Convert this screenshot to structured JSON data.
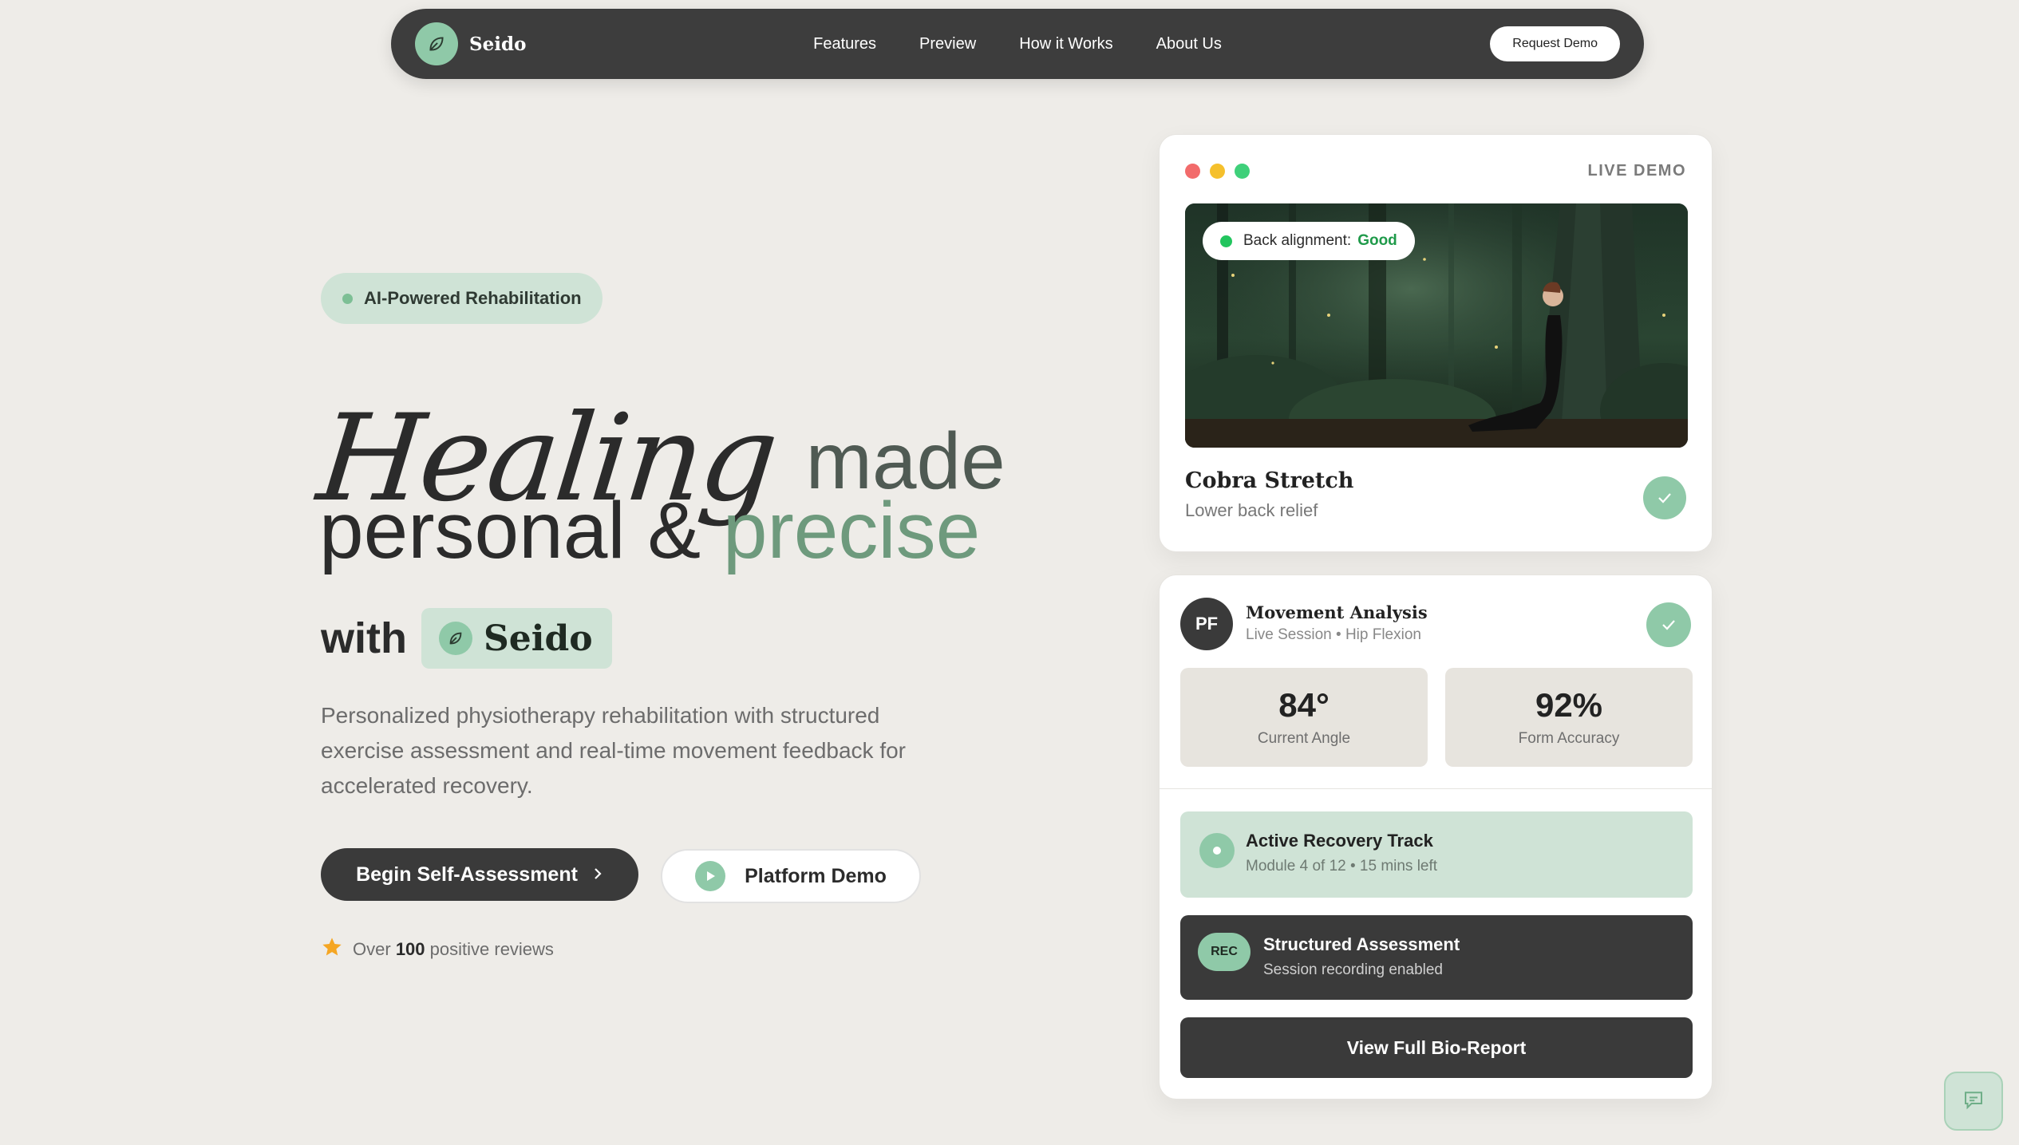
{
  "nav": {
    "brand": "Seido",
    "links": [
      "Features",
      "Preview",
      "How it Works",
      "About Us"
    ],
    "cta": "Request Demo"
  },
  "hero": {
    "badge": "AI-Powered Rehabilitation",
    "headline_script": "Healing",
    "headline_made": "made",
    "headline_line2_a": "personal & ",
    "headline_line2_b": "precise",
    "with_label": "with",
    "with_brand": "Seido",
    "description": "Personalized physiotherapy rehabilitation with structured exercise assessment and real-time movement feedback for accelerated recovery.",
    "primary_cta": "Begin Self-Assessment",
    "secondary_cta": "Platform Demo",
    "reviews_prefix": "Over",
    "reviews_count": "100",
    "reviews_suffix": "positive reviews"
  },
  "demo_card": {
    "label": "LIVE DEMO",
    "pill_label": "Back alignment:",
    "pill_value": "Good",
    "exercise_title": "Cobra Stretch",
    "exercise_subtitle": "Lower back relief"
  },
  "analysis_card": {
    "avatar": "PF",
    "title": "Movement Analysis",
    "subtitle": "Live Session • Hip Flexion",
    "stats": [
      {
        "value": "84°",
        "label": "Current Angle"
      },
      {
        "value": "92%",
        "label": "Form Accuracy"
      }
    ],
    "track_title": "Active Recovery Track",
    "track_sub": "Module 4 of 12 • 15 mins left",
    "rec_badge": "REC",
    "rec_title": "Structured Assessment",
    "rec_sub": "Session recording enabled",
    "report_button": "View Full Bio-Report"
  },
  "colors": {
    "background": "#eeece8",
    "dark": "#3a3a3a",
    "accent_green": "#8fc9a8",
    "accent_light": "#cfe3d6",
    "good_green": "#1f9a4a"
  },
  "icons": [
    "leaf-icon",
    "chevron-right-icon",
    "play-icon",
    "star-icon",
    "check-icon",
    "chat-icon"
  ]
}
